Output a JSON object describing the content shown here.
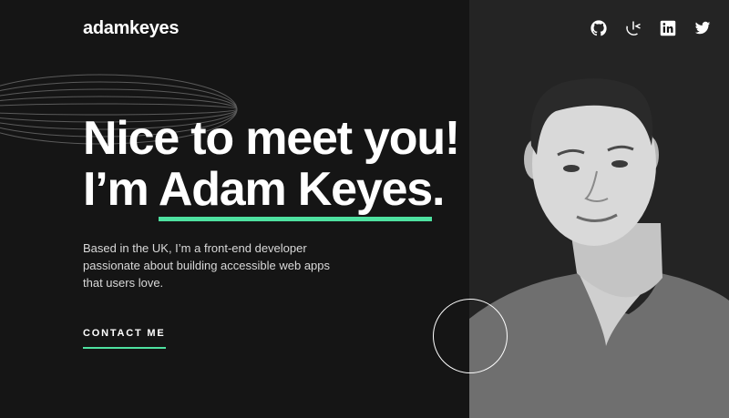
{
  "header": {
    "logo": "adamkeyes",
    "social": [
      {
        "name": "github-icon"
      },
      {
        "name": "frontend-mentor-icon"
      },
      {
        "name": "linkedin-icon"
      },
      {
        "name": "twitter-icon"
      }
    ]
  },
  "hero": {
    "headline_line1": "Nice to meet you!",
    "headline_prefix": "I’m ",
    "headline_name": "Adam Keyes",
    "headline_suffix": ".",
    "bio": "Based in the UK, I’m a front-end developer passionate about building accessible web apps that users love.",
    "contact_label": "CONTACT ME"
  },
  "colors": {
    "background": "#151515",
    "panel": "#242424",
    "accent": "#4ee1a0",
    "text": "#ffffff"
  }
}
